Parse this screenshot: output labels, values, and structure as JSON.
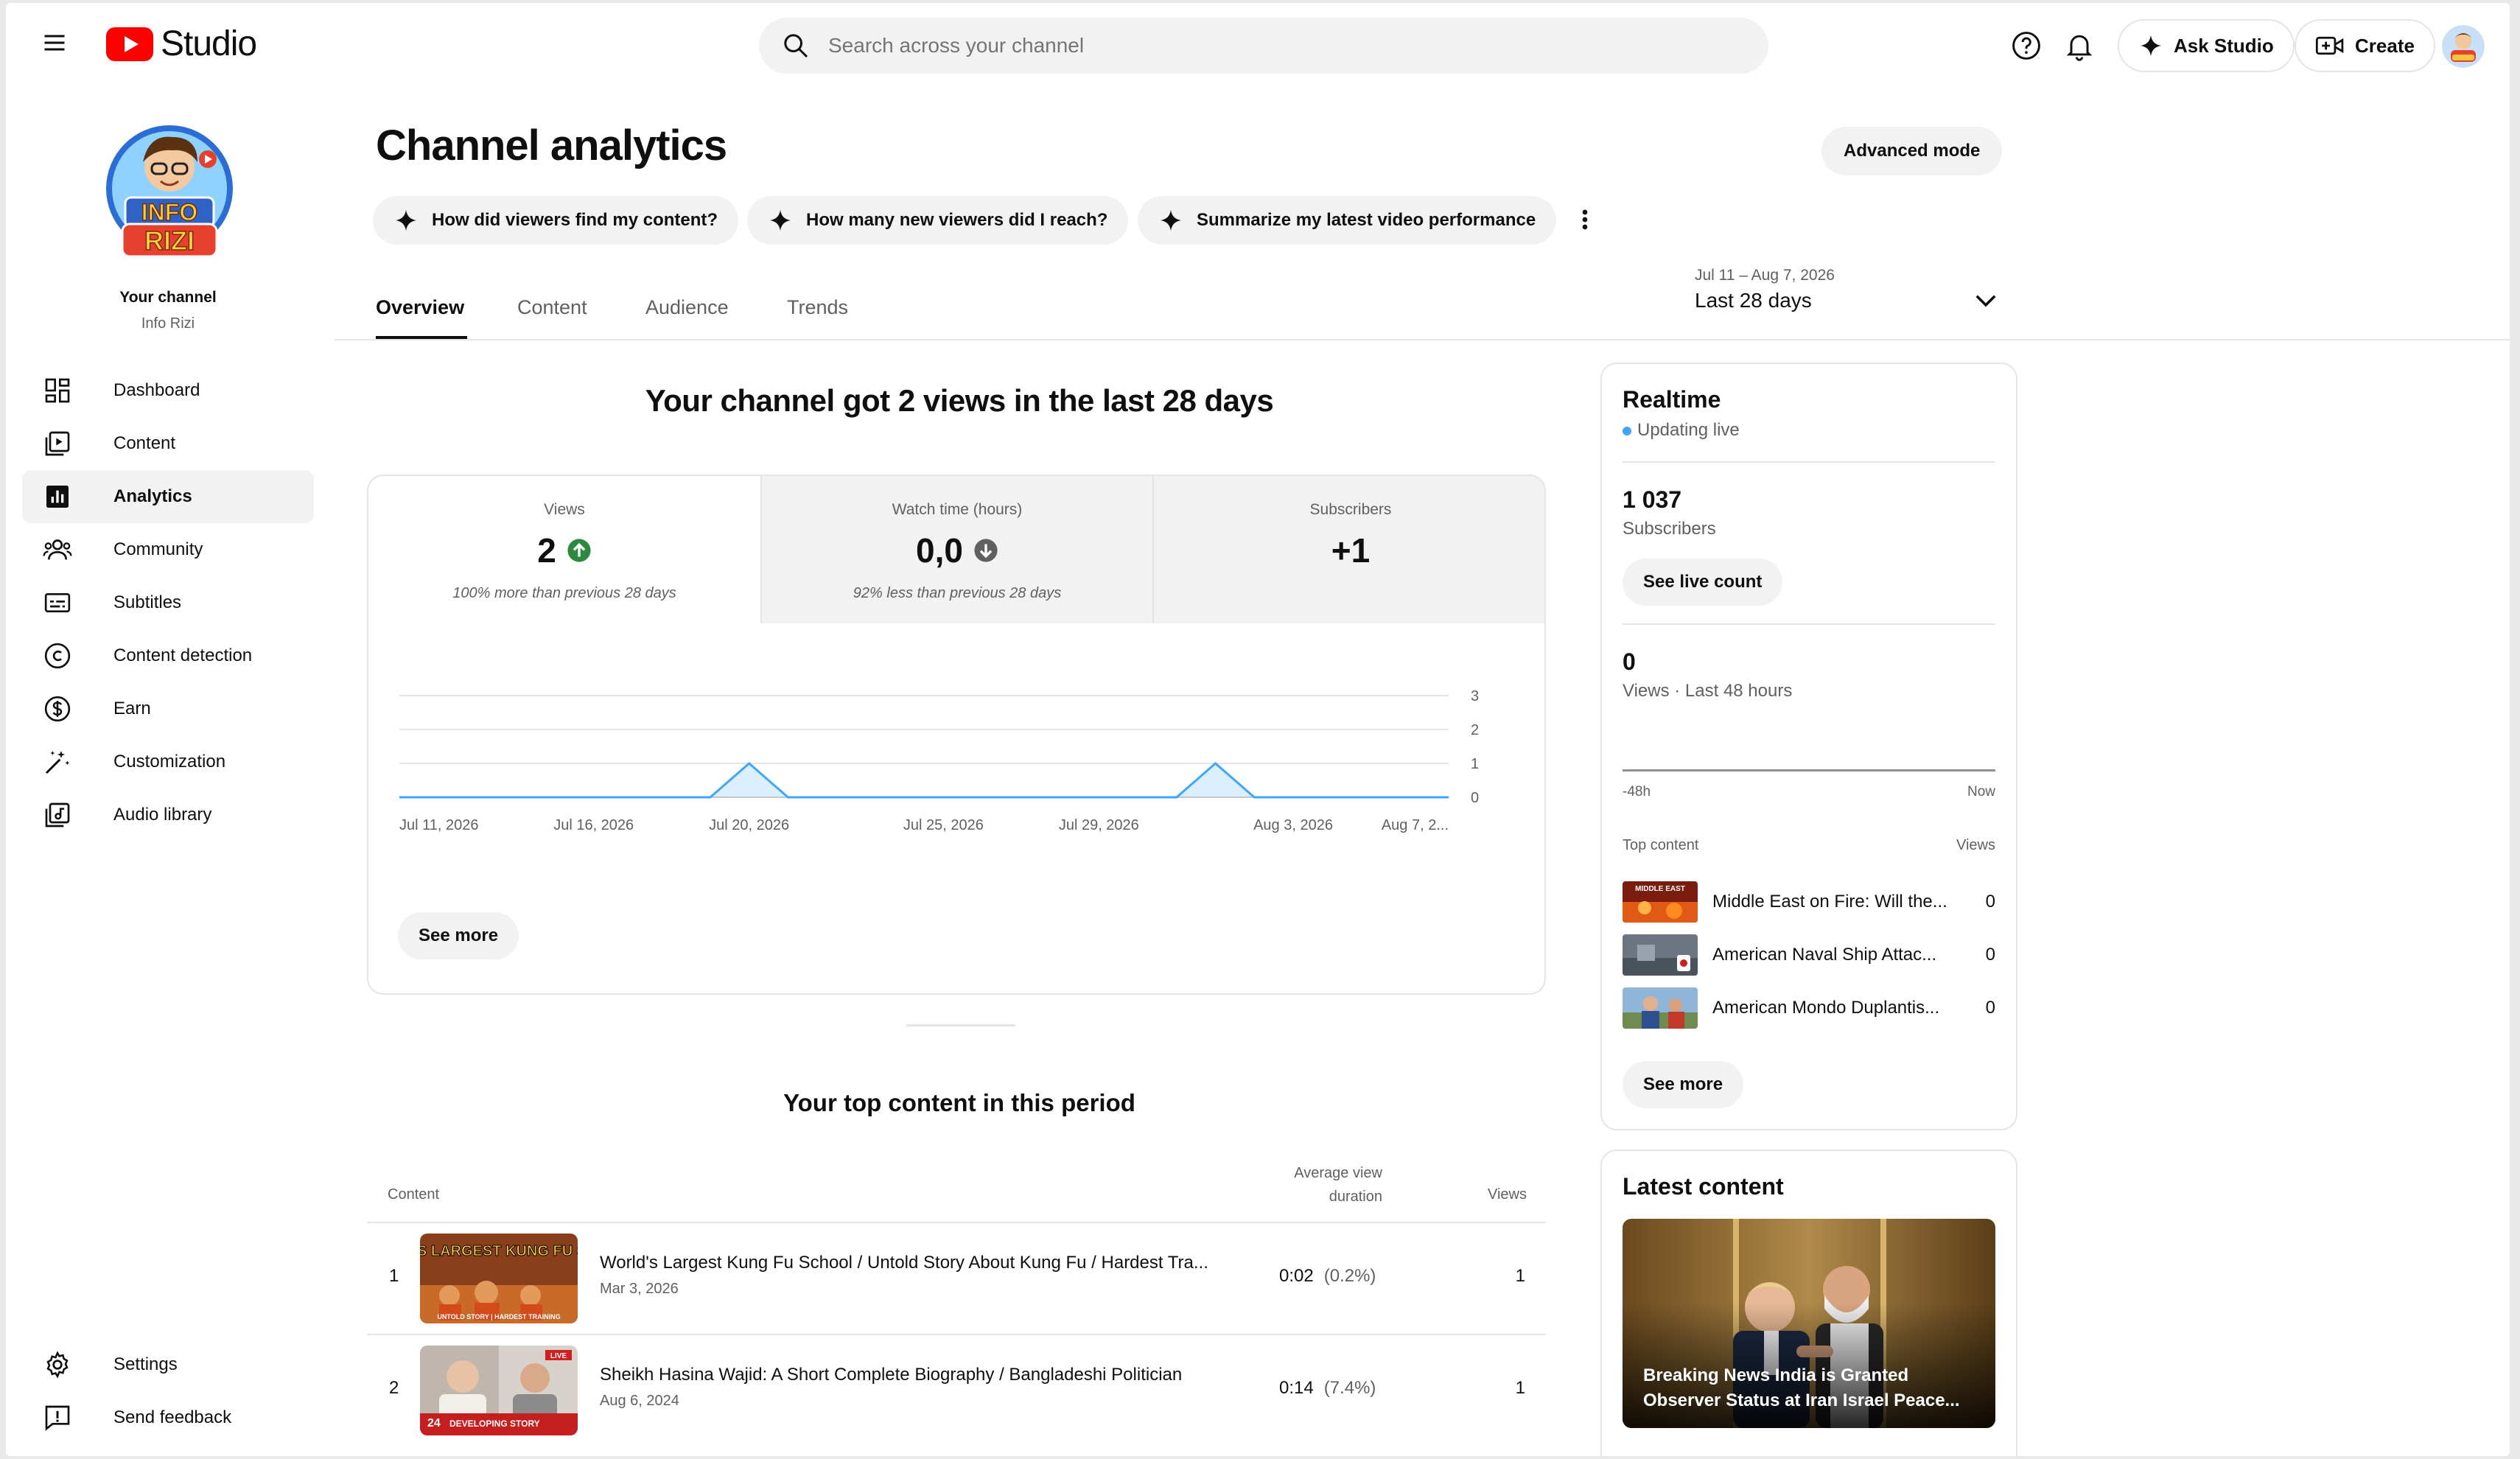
{
  "app": {
    "logo_text": "Studio"
  },
  "search": {
    "placeholder": "Search across your channel"
  },
  "topbar": {
    "ask_label": "Ask Studio",
    "create_label": "Create"
  },
  "channel": {
    "your_channel": "Your channel",
    "name": "Info Rizi",
    "logo_line1": "INFO",
    "logo_line2": "RIZI"
  },
  "sidebar": {
    "items": [
      {
        "label": "Dashboard",
        "icon": "dashboard-icon"
      },
      {
        "label": "Content",
        "icon": "content-icon"
      },
      {
        "label": "Analytics",
        "icon": "analytics-icon",
        "active": true
      },
      {
        "label": "Community",
        "icon": "community-icon"
      },
      {
        "label": "Subtitles",
        "icon": "subtitles-icon"
      },
      {
        "label": "Content detection",
        "icon": "copyright-icon"
      },
      {
        "label": "Earn",
        "icon": "dollar-icon"
      },
      {
        "label": "Customization",
        "icon": "magic-wand-icon"
      },
      {
        "label": "Audio library",
        "icon": "audio-library-icon"
      }
    ],
    "bottom": [
      {
        "label": "Settings",
        "icon": "gear-icon"
      },
      {
        "label": "Send feedback",
        "icon": "feedback-icon"
      }
    ]
  },
  "header": {
    "title": "Channel analytics",
    "advanced_mode": "Advanced mode",
    "chips": [
      "How did viewers find my content?",
      "How many new viewers did I reach?",
      "Summarize my latest video performance"
    ],
    "tabs": [
      "Overview",
      "Content",
      "Audience",
      "Trends"
    ],
    "date_range": {
      "dates": "Jul 11 – Aug 7, 2026",
      "label": "Last 28 days"
    }
  },
  "overview": {
    "headline": "Your channel got 2 views in the last 28 days",
    "stats": [
      {
        "label": "Views",
        "value": "2",
        "trend": "up",
        "comparison": "100% more than previous 28 days"
      },
      {
        "label": "Watch time (hours)",
        "value": "0,0",
        "trend": "down",
        "comparison": "92% less than previous 28 days"
      },
      {
        "label": "Subscribers",
        "value": "+1",
        "trend": "none",
        "comparison": ""
      }
    ],
    "see_more": "See more"
  },
  "chart_data": {
    "type": "area",
    "x_tick_labels": [
      "Jul 11, 2026",
      "Jul 16, 2026",
      "Jul 20, 2026",
      "Jul 25, 2026",
      "Jul 29, 2026",
      "Aug 3, 2026",
      "Aug 7, 2..."
    ],
    "x": [
      "2026-07-11",
      "2026-07-12",
      "2026-07-13",
      "2026-07-14",
      "2026-07-15",
      "2026-07-16",
      "2026-07-17",
      "2026-07-18",
      "2026-07-19",
      "2026-07-20",
      "2026-07-21",
      "2026-07-22",
      "2026-07-23",
      "2026-07-24",
      "2026-07-25",
      "2026-07-26",
      "2026-07-27",
      "2026-07-28",
      "2026-07-29",
      "2026-07-30",
      "2026-07-31",
      "2026-08-01",
      "2026-08-02",
      "2026-08-03",
      "2026-08-04",
      "2026-08-05",
      "2026-08-06",
      "2026-08-07"
    ],
    "series": [
      {
        "values": [
          0,
          0,
          0,
          0,
          0,
          0,
          0,
          0,
          0,
          1,
          0,
          0,
          0,
          0,
          0,
          0,
          0,
          0,
          0,
          0,
          0,
          1,
          0,
          0,
          0,
          0,
          0,
          0
        ]
      }
    ],
    "y_ticks": [
      "0",
      "1",
      "2",
      "3"
    ],
    "ylim": [
      0,
      3
    ],
    "grid": true,
    "color": "#3ea6ff"
  },
  "top_content": {
    "title": "Your top content in this period",
    "columns": {
      "content": "Content",
      "avg_view_duration": "Average view duration",
      "views": "Views"
    },
    "rows": [
      {
        "rank": "1",
        "title": "World's Largest Kung Fu School / Untold Story About Kung Fu / Hardest Tra...",
        "date": "Mar 3, 2026",
        "duration": "0:02",
        "percent": "(0.2%)",
        "views": "1",
        "thumb_text": "WORLD'S LARGEST KUNG FU SCHOOL",
        "thumb_sub": "UNTOLD STORY | HARDEST TRAINING"
      },
      {
        "rank": "2",
        "title": "Sheikh Hasina Wajid: A Short Complete Biography / Bangladeshi Politician",
        "date": "Aug 6, 2024",
        "duration": "0:14",
        "percent": "(7.4%)",
        "views": "1",
        "thumb_text": "DEVELOPING STORY",
        "thumb_sub": "24",
        "thumb_badge": "LIVE"
      }
    ]
  },
  "realtime": {
    "title": "Realtime",
    "status": "Updating live",
    "subscribers_value": "1 037",
    "subscribers_label": "Subscribers",
    "see_live_count": "See live count",
    "views_value": "0",
    "views_label": "Views · Last 48 hours",
    "axis_start": "-48h",
    "axis_end": "Now",
    "top_content_label": "Top content",
    "views_col_label": "Views",
    "items": [
      {
        "title": "Middle East on Fire: Will the...",
        "views": "0",
        "thumb_text": "MIDDLE EAST"
      },
      {
        "title": "American Naval Ship Attac...",
        "views": "0"
      },
      {
        "title": "American Mondo Duplantis...",
        "views": "0"
      }
    ],
    "see_more": "See more"
  },
  "latest": {
    "title": "Latest content",
    "video_title": "Breaking News India is Granted Observer Status at Iran Israel Peace..."
  }
}
